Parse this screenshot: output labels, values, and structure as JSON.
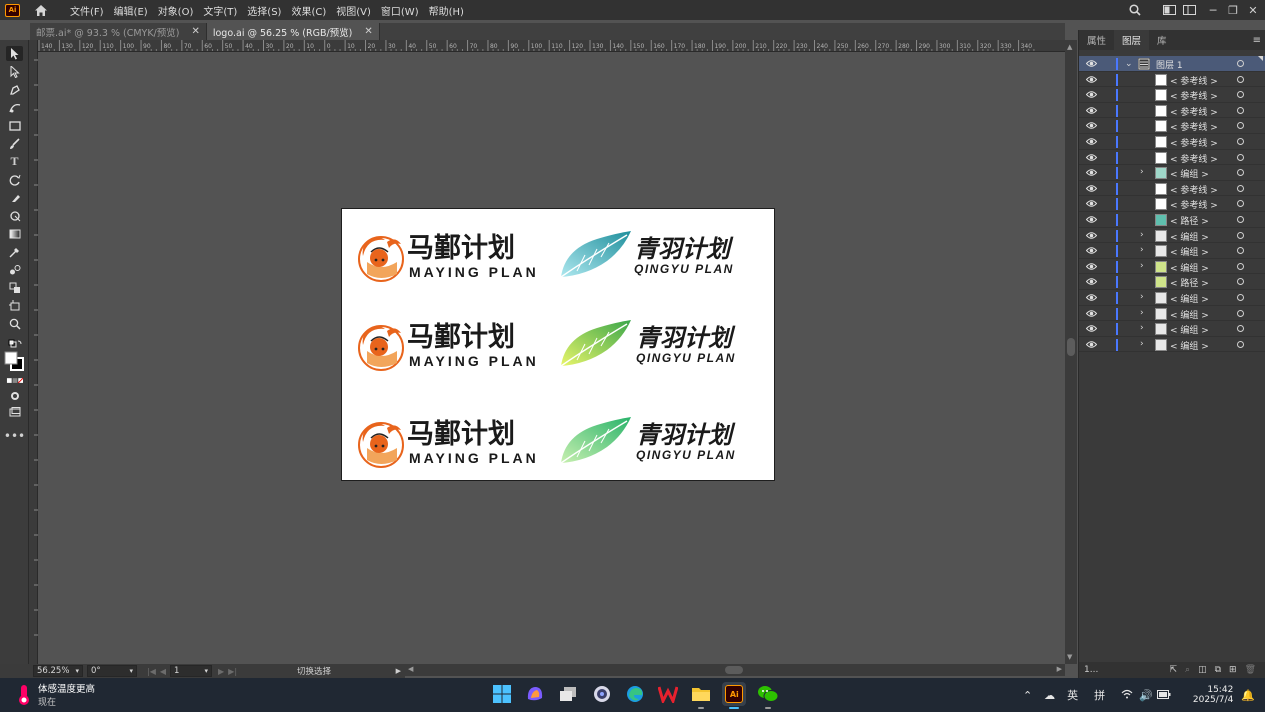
{
  "app": {
    "logo_text": "Ai"
  },
  "menu": [
    "文件(F)",
    "编辑(E)",
    "对象(O)",
    "文字(T)",
    "选择(S)",
    "效果(C)",
    "视图(V)",
    "窗口(W)",
    "帮助(H)"
  ],
  "tabs": [
    {
      "label": "邮票.ai* @ 93.3 % (CMYK/预览)",
      "active": false
    },
    {
      "label": "logo.ai @ 56.25 % (RGB/预览)",
      "active": true
    }
  ],
  "ruler_marks": [
    "140",
    "130",
    "120",
    "110",
    "100",
    "90",
    "80",
    "70",
    "60",
    "50",
    "40",
    "30",
    "20",
    "10",
    "0",
    "10",
    "20",
    "30",
    "40",
    "50",
    "60",
    "70",
    "80",
    "90",
    "100",
    "110",
    "120",
    "130",
    "140",
    "150",
    "160",
    "170",
    "180",
    "190",
    "200",
    "210",
    "220",
    "230",
    "240",
    "250",
    "260",
    "270",
    "280",
    "290",
    "300",
    "310",
    "320",
    "330",
    "340"
  ],
  "logos": {
    "left_cn": "马鄞计划",
    "left_en": "MAYING PLAN",
    "right_cn": "青羽计划",
    "right_en": "QINGYU PLAN"
  },
  "statusbar": {
    "zoom": "56.25%",
    "rotation": "0°",
    "artboard": "1",
    "mode": "切换选择"
  },
  "panel": {
    "tabs": [
      "属性",
      "图层",
      "库"
    ],
    "active_tab": "图层",
    "top_layer": "图层 1",
    "layers": [
      {
        "name": "< 参考线 >",
        "expandable": false
      },
      {
        "name": "< 参考线 >",
        "expandable": false
      },
      {
        "name": "< 参考线 >",
        "expandable": false
      },
      {
        "name": "< 参考线 >",
        "expandable": false
      },
      {
        "name": "< 参考线 >",
        "expandable": false
      },
      {
        "name": "< 参考线 >",
        "expandable": false
      },
      {
        "name": "< 编组 >",
        "expandable": true
      },
      {
        "name": "< 参考线 >",
        "expandable": false
      },
      {
        "name": "< 参考线 >",
        "expandable": false
      },
      {
        "name": "< 路径 >",
        "expandable": false
      },
      {
        "name": "< 编组 >",
        "expandable": true
      },
      {
        "name": "< 编组 >",
        "expandable": true
      },
      {
        "name": "< 编组 >",
        "expandable": true
      },
      {
        "name": "< 路径 >",
        "expandable": false
      },
      {
        "name": "< 编组 >",
        "expandable": true
      },
      {
        "name": "< 编组 >",
        "expandable": true
      },
      {
        "name": "< 编组 >",
        "expandable": true
      },
      {
        "name": "< 编组 >",
        "expandable": true
      }
    ],
    "footer_count": "1..."
  },
  "taskbar": {
    "weather_title": "体感温度更高",
    "weather_sub": "现在",
    "lang1": "英",
    "lang2": "拼",
    "time": "15:42",
    "date": "2025/7/4"
  },
  "colors": {
    "accent": "#ff9a00",
    "layer_bar": "#4a78ff",
    "feather_teal": "#2a9fa8",
    "feather_lime": "#a7d62a",
    "feather_green": "#3fbf6e",
    "mascot_orange": "#e8641c"
  }
}
